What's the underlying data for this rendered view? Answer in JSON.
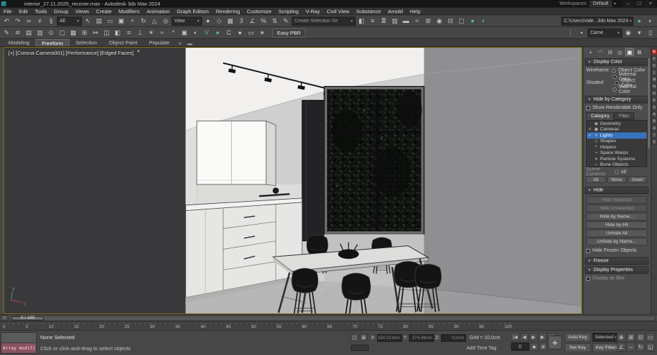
{
  "titlebar": {
    "title": "interior_27.11.2025_recover.max - Autodesk 3ds Max 2024",
    "workspace_label": "Workspaces:",
    "workspace_value": "Default",
    "minimize": "–",
    "maximize": "□",
    "close": "×"
  },
  "menubar": {
    "items": [
      "File",
      "Edit",
      "Tools",
      "Group",
      "Views",
      "Create",
      "Modifiers",
      "Animation",
      "Graph Editors",
      "Rendering",
      "Customize",
      "Scripting",
      "V-Ray",
      "Civil View",
      "Substance",
      "Arnold",
      "Help"
    ]
  },
  "toolbar1": {
    "icons_a": [
      {
        "name": "undo-icon",
        "glyph": "↶"
      },
      {
        "name": "redo-icon",
        "glyph": "↷"
      },
      {
        "name": "select-and-link-icon",
        "glyph": "∞"
      },
      {
        "name": "unlink-selection-icon",
        "glyph": "≠"
      },
      {
        "name": "bind-to-space-warp-icon",
        "glyph": "§"
      }
    ],
    "filter_value": "All",
    "icons_b": [
      {
        "name": "select-object-icon",
        "glyph": "↖"
      },
      {
        "name": "select-by-name-icon",
        "glyph": "▤"
      },
      {
        "name": "selection-region-icon",
        "glyph": "▭"
      },
      {
        "name": "window-crossing-icon",
        "glyph": "▣"
      },
      {
        "name": "select-and-move-icon",
        "glyph": "+"
      },
      {
        "name": "select-and-rotate-icon",
        "glyph": "↻"
      },
      {
        "name": "select-and-scale-icon",
        "glyph": "△"
      },
      {
        "name": "select-and-place-icon",
        "glyph": "◎"
      }
    ],
    "coord_value": "View",
    "icons_c": [
      {
        "name": "use-pivot-center-icon",
        "glyph": "●"
      },
      {
        "name": "select-and-manipulate-icon",
        "glyph": "◇"
      },
      {
        "name": "keyboard-shortcut-override-icon",
        "glyph": "▦"
      },
      {
        "name": "snaps-toggle-icon",
        "glyph": "3"
      },
      {
        "name": "angle-snap-icon",
        "glyph": "∠"
      },
      {
        "name": "percent-snap-icon",
        "glyph": "%"
      },
      {
        "name": "spinner-snap-icon",
        "glyph": "⇅"
      },
      {
        "name": "edit-named-selection-sets-icon",
        "glyph": "✎"
      }
    ],
    "selection_set": "Create Selection Se",
    "icons_d": [
      {
        "name": "mirror-icon",
        "glyph": "◧"
      },
      {
        "name": "align-icon",
        "glyph": "≡"
      },
      {
        "name": "toggle-scene-explorer-icon",
        "glyph": "≣"
      },
      {
        "name": "toggle-layer-explorer-icon",
        "glyph": "▥"
      },
      {
        "name": "toggle-ribbon-icon",
        "glyph": "▬"
      },
      {
        "name": "curve-editor-icon",
        "glyph": "≈"
      },
      {
        "name": "schematic-view-icon",
        "glyph": "⊞"
      },
      {
        "name": "material-editor-icon",
        "glyph": "◉"
      },
      {
        "name": "render-setup-icon",
        "glyph": "⊟"
      },
      {
        "name": "rendered-frame-window-icon",
        "glyph": "▢"
      },
      {
        "name": "render-production-icon",
        "glyph": "●",
        "teal": true
      },
      {
        "name": "render-iterative-icon",
        "glyph": "◐",
        "teal": true
      }
    ],
    "path_value": "C:\\Users\\Vale...3ds Max 2024",
    "icons_e": [
      {
        "name": "render-shortcut-icon",
        "glyph": "●",
        "teal": true
      },
      {
        "name": "gpu-render-icon",
        "glyph": "◐"
      }
    ]
  },
  "toolbar2": {
    "icons_a": [
      {
        "name": "scene-script-icon",
        "glyph": "✎"
      },
      {
        "name": "mini-listener-icon",
        "glyph": "≋"
      },
      {
        "name": "layer-manager-icon",
        "glyph": "▤"
      },
      {
        "name": "scene-explorer-2-icon",
        "glyph": "▥"
      },
      {
        "name": "isolate-selection-icon",
        "glyph": "⊙"
      },
      {
        "name": "display-floater-icon",
        "glyph": "▢"
      },
      {
        "name": "named-views-icon",
        "glyph": "▦"
      },
      {
        "name": "array-tool-icon",
        "glyph": "⊞"
      },
      {
        "name": "spacing-tool-icon",
        "glyph": "↦"
      },
      {
        "name": "snapshot-icon",
        "glyph": "◫"
      },
      {
        "name": "mirror-tool-icon",
        "glyph": "◧"
      },
      {
        "name": "align-tool-icon",
        "glyph": "≡"
      },
      {
        "name": "normal-align-icon",
        "glyph": "⊥"
      },
      {
        "name": "place-highlight-icon",
        "glyph": "☀"
      },
      {
        "name": "environment-dialog-icon",
        "glyph": "≈"
      },
      {
        "name": "effects-dialog-icon",
        "glyph": "*"
      },
      {
        "name": "batch-render-icon",
        "glyph": "▣"
      },
      {
        "name": "render-presets-icon",
        "glyph": "◐"
      },
      {
        "name": "vray-frame-buffer-icon",
        "glyph": "V",
        "teal": true
      },
      {
        "name": "vray-settings-icon",
        "glyph": "●",
        "teal": true
      },
      {
        "name": "corona-frame-buffer-icon",
        "glyph": "C",
        "orange": true
      },
      {
        "name": "corona-settings-icon",
        "glyph": "●",
        "orange": true
      },
      {
        "name": "safe-frames-icon",
        "glyph": "▭"
      },
      {
        "name": "show-statistics-icon",
        "glyph": "∗"
      }
    ],
    "easy_pbr": "Easy PBR",
    "icons_b": [
      {
        "name": "toolbar-grip-icon",
        "glyph": "⋮"
      },
      {
        "name": "target-weld-icon",
        "glyph": "▪"
      }
    ],
    "camera_value": "Came",
    "icons_c": [
      {
        "name": "camera-lock-icon",
        "glyph": "◉"
      },
      {
        "name": "camera-select-icon",
        "glyph": "▾"
      },
      {
        "name": "viewport-layout-icon",
        "glyph": "▯"
      }
    ]
  },
  "ribbon": {
    "tabs": [
      {
        "label": "Modeling"
      },
      {
        "label": "Freeform",
        "active": true
      },
      {
        "label": "Selection"
      },
      {
        "label": "Object Paint"
      },
      {
        "label": "Populate"
      }
    ],
    "caret": "▾",
    "collapse": "▬"
  },
  "viewport": {
    "label": "[+] [Corona Camera001] [Performance] [Edged Faces]",
    "funnel": "▼"
  },
  "cmd": {
    "tabs": [
      {
        "name": "create-tab",
        "glyph": "+"
      },
      {
        "name": "modify-tab",
        "glyph": "◠"
      },
      {
        "name": "hierarchy-tab",
        "glyph": "⊟"
      },
      {
        "name": "motion-tab",
        "glyph": "◎"
      },
      {
        "name": "display-tab",
        "glyph": "▣",
        "active": true
      },
      {
        "name": "utilities-tab",
        "glyph": "⊠"
      }
    ],
    "display_color": {
      "title": "Display Color",
      "wireframe_label": "Wireframe:",
      "shaded_label": "Shaded:",
      "object_color": "Object Color",
      "material_color": "Material Color"
    },
    "hide_by_category": {
      "title": "Hide by Category",
      "show_renderable": "Show Renderable Only",
      "tabs": [
        {
          "label": "Category",
          "active": true
        },
        {
          "label": "Filter"
        }
      ],
      "items": [
        {
          "name": "category-geometry",
          "icon": "◉",
          "label": "Geometry"
        },
        {
          "name": "category-cameras",
          "icon": "▣",
          "label": "Cameras",
          "checked": true
        },
        {
          "name": "category-lights",
          "icon": "☀",
          "label": "Lights",
          "checked": true,
          "selected": true
        },
        {
          "name": "category-shapes",
          "icon": "◇",
          "label": "Shapes"
        },
        {
          "name": "category-helpers",
          "icon": "+",
          "label": "Helpers"
        },
        {
          "name": "category-space-warps",
          "icon": "≈",
          "label": "Space Warps"
        },
        {
          "name": "category-particle-systems",
          "icon": "∗",
          "label": "Particle Systems"
        },
        {
          "name": "category-bone-objects",
          "icon": "⌐",
          "label": "Bone Objects"
        }
      ],
      "scene_label": "Scene Contents",
      "scene_radio": "All",
      "buttons": [
        {
          "name": "category-all-button",
          "label": "All"
        },
        {
          "name": "category-none-button",
          "label": "None"
        },
        {
          "name": "category-invert-button",
          "label": "Invert"
        }
      ]
    },
    "hide": {
      "title": "Hide",
      "buttons": [
        {
          "name": "hide-selected-button",
          "label": "Hide Selected",
          "disabled": true
        },
        {
          "name": "hide-unselected-button",
          "label": "Hide Unselected",
          "disabled": true
        },
        {
          "name": "hide-by-name-button",
          "label": "Hide by Name..."
        },
        {
          "name": "hide-by-hit-button",
          "label": "Hide by Hit"
        },
        {
          "name": "unhide-all-button",
          "label": "Unhide All",
          "gap": true
        },
        {
          "name": "unhide-by-name-button",
          "label": "Unhide by Name..."
        }
      ],
      "frozen_checkbox": "Hide Frozen Objects"
    },
    "freeze": {
      "title": "Freeze"
    },
    "display_properties": {
      "title": "Display Properties",
      "display_as_box": "Display as Box"
    }
  },
  "vstrip": {
    "icons": [
      {
        "name": "vray-render-icon",
        "glyph": "R",
        "hot": true
      },
      {
        "name": "vray-vfb-icon",
        "glyph": "F"
      },
      {
        "name": "vray-camera-lister-icon",
        "glyph": "C"
      },
      {
        "name": "vray-light-lister-icon",
        "glyph": "L"
      },
      {
        "name": "vray-material-icon",
        "glyph": "M"
      },
      {
        "name": "vray-node-icon",
        "glyph": "N"
      },
      {
        "name": "vray-displacement-icon",
        "glyph": "D"
      },
      {
        "name": "vray-proxy-icon",
        "glyph": "P"
      },
      {
        "name": "vray-sphere-icon",
        "glyph": "S"
      },
      {
        "name": "vray-toolbar-a-icon",
        "glyph": "A"
      },
      {
        "name": "vray-toolbar-b-icon",
        "glyph": "B"
      },
      {
        "name": "vray-toolbar-g-icon",
        "glyph": "G"
      },
      {
        "name": "vray-toolbar-t-icon",
        "glyph": "T"
      },
      {
        "name": "vray-toolbar-v-icon",
        "glyph": "V"
      }
    ]
  },
  "timeline": {
    "slider": "0 / 100",
    "curve_editor_glyph": "≈",
    "ticks": [
      "0",
      "5",
      "10",
      "15",
      "20",
      "25",
      "30",
      "35",
      "40",
      "45",
      "50",
      "55",
      "60",
      "65",
      "70",
      "75",
      "80",
      "85",
      "90",
      "95",
      "100"
    ]
  },
  "status": {
    "maxscript_text": "Array modifi",
    "selection": "None Selected",
    "prompt": "Click or click-and-drag to select objects",
    "small_icons": [
      {
        "name": "isolate-selection-toggle-icon",
        "glyph": "▢"
      },
      {
        "name": "selection-lock-toggle-icon",
        "glyph": "⊠"
      }
    ],
    "coords": {
      "x_label": "X:",
      "x": "150,023cm",
      "y_label": "Y:",
      "y": "274,46cm",
      "z_label": "Z:",
      "z": "0,0cm"
    },
    "grid": "Grid = 10,0cm",
    "time_tag": "Add Time Tag",
    "playback_row1": [
      {
        "name": "go-to-start-button",
        "glyph": "|◀"
      },
      {
        "name": "previous-frame-button",
        "glyph": "◀"
      },
      {
        "name": "play-button",
        "glyph": "▶"
      },
      {
        "name": "next-frame-button",
        "glyph": "▶"
      },
      {
        "name": "go-to-end-button",
        "glyph": "▶|"
      }
    ],
    "frame_value": "0",
    "playback_row2": [
      {
        "name": "key-mode-toggle-button",
        "glyph": "◆"
      },
      {
        "name": "time-configuration-button",
        "glyph": "⊞"
      }
    ],
    "add_plus": "+",
    "auto_key": "Auto Key",
    "selected_dd": "Selected",
    "set_key": "Set Key",
    "key_filters": "Key Filters...",
    "nav_icons": [
      {
        "name": "zoom-icon",
        "glyph": "⊕"
      },
      {
        "name": "zoom-all-icon",
        "glyph": "⊞"
      },
      {
        "name": "zoom-extents-icon",
        "glyph": "⊡"
      },
      {
        "name": "zoom-region-icon",
        "glyph": "▭"
      },
      {
        "name": "field-of-view-icon",
        "glyph": "∠"
      },
      {
        "name": "pan-icon",
        "glyph": "⇔"
      },
      {
        "name": "orbit-icon",
        "glyph": "↻"
      },
      {
        "name": "maximize-viewport-toggle-icon",
        "glyph": "◱"
      }
    ]
  }
}
